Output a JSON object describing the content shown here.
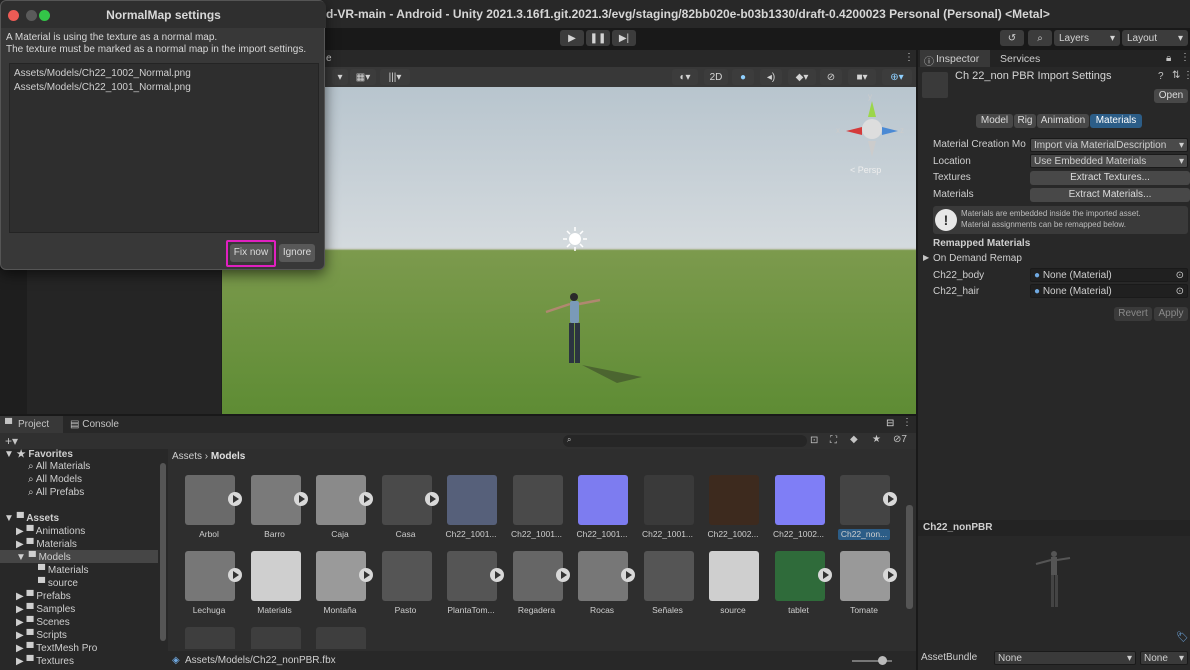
{
  "window": {
    "title": "d-VR-main - Android - Unity 2021.3.16f1.git.2021.3/evg/staging/82bb020e-b03b1330/draft-0.4200023 Personal (Personal) <Metal>"
  },
  "toolbar": {
    "layers_label": "Layers",
    "layout_label": "Layout"
  },
  "scene": {
    "mode_2d": "2D",
    "tab_suffix": "e",
    "gizmo_persp": "< Persp"
  },
  "dialog": {
    "title": "NormalMap settings",
    "message_line1": "A Material is using the texture as a normal map.",
    "message_line2": "The texture must be marked as a normal map in the import settings.",
    "files": [
      "Assets/Models/Ch22_1002_Normal.png",
      "Assets/Models/Ch22_1001_Normal.png"
    ],
    "fix_label": "Fix now",
    "ignore_label": "Ignore"
  },
  "inspector": {
    "tab_inspector": "Inspector",
    "tab_services": "Services",
    "header_title": "Ch 22_non PBR Import Settings",
    "open_label": "Open",
    "tabs": [
      "Model",
      "Rig",
      "Animation",
      "Materials"
    ],
    "rows": {
      "material_creation_label": "Material Creation Mo",
      "material_creation_value": "Import via MaterialDescription",
      "location_label": "Location",
      "location_value": "Use Embedded Materials",
      "textures_label": "Textures",
      "textures_button": "Extract Textures...",
      "materials_label": "Materials",
      "materials_button": "Extract Materials..."
    },
    "info_line1": "Materials are embedded inside the imported asset.",
    "info_line2": "Material assignments can be remapped below.",
    "remapped_title": "Remapped Materials",
    "on_demand": "On Demand Remap",
    "remaps": [
      {
        "name": "Ch22_body",
        "value": "None (Material)"
      },
      {
        "name": "Ch22_hair",
        "value": "None (Material)"
      }
    ],
    "revert_label": "Revert",
    "apply_label": "Apply",
    "preview_title": "Ch22_nonPBR",
    "assetbundle_label": "AssetBundle",
    "assetbundle_value": "None",
    "assetbundle_variant": "None"
  },
  "project": {
    "tab_project": "Project",
    "tab_console": "Console",
    "hidden_count": "7",
    "favorites_title": "Favorites",
    "favorites": [
      "All Materials",
      "All Models",
      "All Prefabs"
    ],
    "assets_title": "Assets",
    "tree": [
      "Animations",
      "Materials",
      "Models",
      "Materials",
      "source",
      "Prefabs",
      "Samples",
      "Scenes",
      "Scripts",
      "TextMesh Pro",
      "Textures"
    ],
    "breadcrumb_root": "Assets",
    "breadcrumb_current": "Models",
    "row1": [
      "Arbol",
      "Barro",
      "Caja",
      "Casa",
      "Ch22_1001...",
      "Ch22_1001...",
      "Ch22_1001...",
      "Ch22_1001...",
      "Ch22_1002...",
      "Ch22_1002...",
      "Ch22_non..."
    ],
    "row2": [
      "Lechuga",
      "Materials",
      "Montaña",
      "Pasto",
      "PlantaTom...",
      "Regadera",
      "Rocas",
      "Señales",
      "source",
      "tablet",
      "Tomate"
    ],
    "status_path": "Assets/Models/Ch22_nonPBR.fbx"
  },
  "colors": {
    "highlight": "#e020c0",
    "accent": "#2c5d87"
  }
}
